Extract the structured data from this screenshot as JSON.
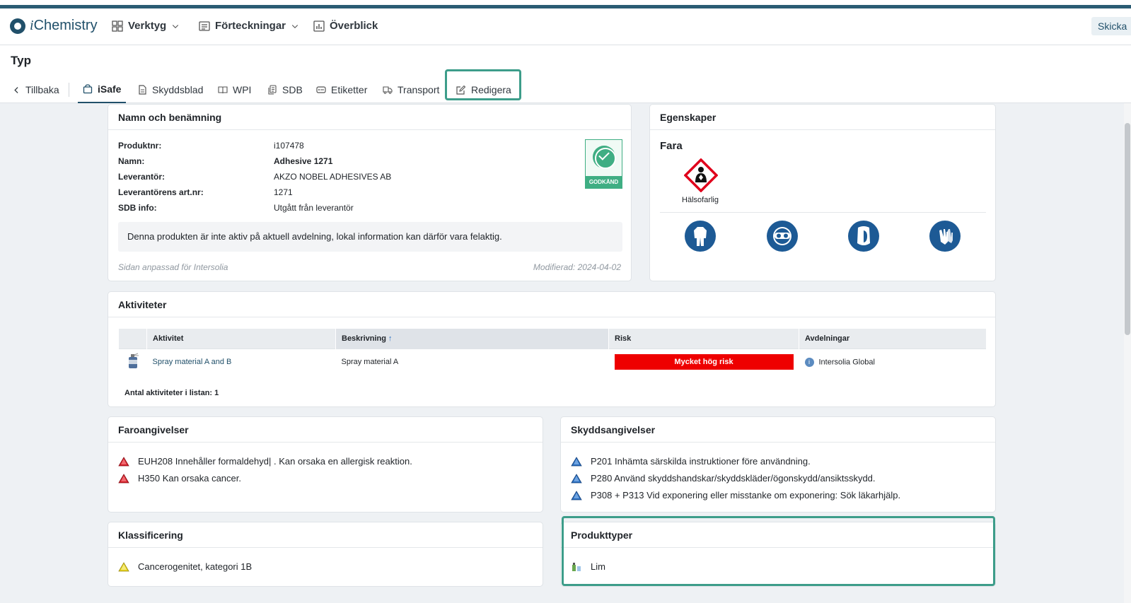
{
  "app": {
    "name_italic": "i",
    "name_rest": "Chemistry"
  },
  "nav": {
    "items": [
      {
        "label": "Verktyg"
      },
      {
        "label": "Förteckningar"
      },
      {
        "label": "Överblick"
      }
    ],
    "send_button": "Skicka"
  },
  "page": {
    "title": "Typ"
  },
  "tabs": {
    "back": "Tillbaka",
    "items": [
      {
        "label": "iSafe",
        "active": true
      },
      {
        "label": "Skyddsblad"
      },
      {
        "label": "WPI"
      },
      {
        "label": "SDB"
      },
      {
        "label": "Etiketter"
      },
      {
        "label": "Transport"
      },
      {
        "label": "Redigera"
      }
    ]
  },
  "naming": {
    "title": "Namn och benämning",
    "rows": [
      {
        "label": "Produktnr:",
        "value": "i107478"
      },
      {
        "label": "Namn:",
        "value": "Adhesive 1271"
      },
      {
        "label": "Leverantör:",
        "value": "AKZO NOBEL ADHESIVES AB"
      },
      {
        "label": "Leverantörens art.nr:",
        "value": "1271"
      },
      {
        "label": "SDB info:",
        "value": "Utgått från leverantör"
      }
    ],
    "approved_badge": "GODKÄND",
    "notice": "Denna produkten är inte aktiv på aktuell avdelning, lokal information kan därför vara felaktig.",
    "adapted": "Sidan anpassad för Intersolia",
    "modified": "Modifierad: 2024-04-02"
  },
  "properties": {
    "title": "Egenskaper",
    "hazard_heading": "Fara",
    "pictogram_label": "Hälsofarlig",
    "ppe_icons": [
      "protective-suit-icon",
      "safety-goggles-icon",
      "face-shield-icon",
      "protective-gloves-icon"
    ]
  },
  "activities": {
    "title": "Aktiviteter",
    "columns": [
      "Aktivitet",
      "Beskrivning",
      "Risk",
      "Avdelningar"
    ],
    "sort_indicator": "↑",
    "rows": [
      {
        "activity": "Spray material A and B",
        "description": "Spray material A",
        "risk": "Mycket hög risk",
        "risk_color": "#ee0000",
        "department": "Intersolia Global"
      }
    ],
    "count_label": "Antal aktiviteter i listan: 1"
  },
  "hazard_statements": {
    "title": "Faroangivelser",
    "items": [
      {
        "text": "EUH208 Innehåller formaldehyd| . Kan orsaka en allergisk reaktion.",
        "color": "#d3202a"
      },
      {
        "text": "H350 Kan orsaka cancer.",
        "color": "#d3202a"
      }
    ]
  },
  "precaution_statements": {
    "title": "Skyddsangivelser",
    "items": [
      {
        "text": "P201 Inhämta särskilda instruktioner före användning.",
        "color": "#2a6fc0"
      },
      {
        "text": "P280 Använd skyddshandskar/skyddskläder/ögonskydd/ansiktsskydd.",
        "color": "#2a6fc0"
      },
      {
        "text": "P308 + P313 Vid exponering eller misstanke om exponering: Sök läkarhjälp.",
        "color": "#2a6fc0"
      }
    ]
  },
  "classification": {
    "title": "Klassificering",
    "items": [
      {
        "text": "Cancerogenitet, kategori 1B",
        "color": "#e6d21c"
      }
    ]
  },
  "product_types": {
    "title": "Produkttyper",
    "items": [
      {
        "text": "Lim"
      }
    ]
  },
  "colors": {
    "brand": "#21506a",
    "accent_highlight": "#3d9d8a",
    "approved": "#3fae83"
  }
}
